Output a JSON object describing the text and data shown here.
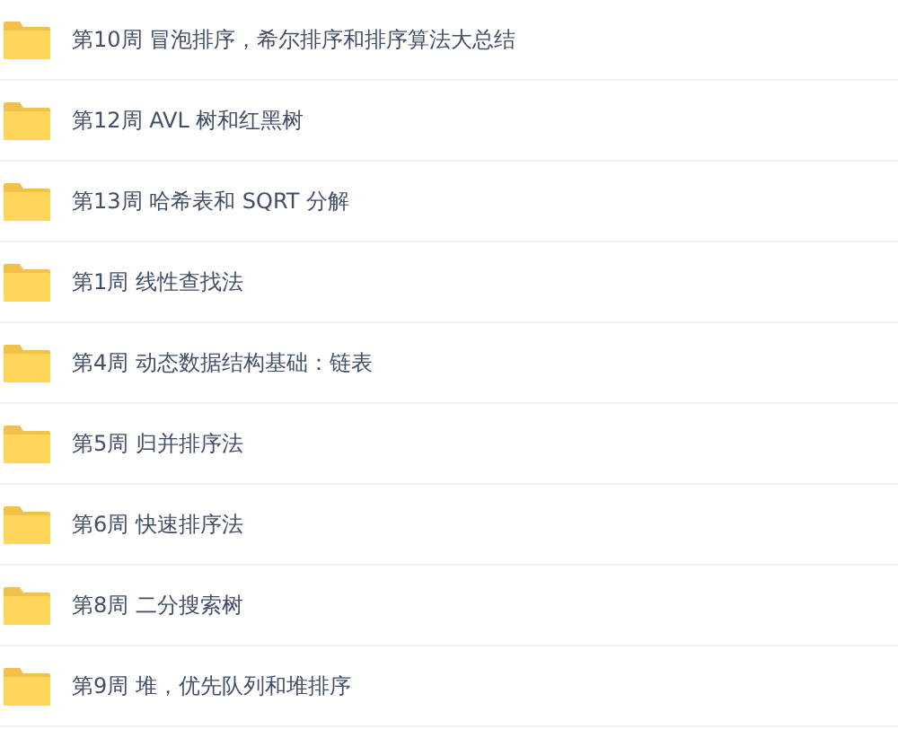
{
  "folders": [
    {
      "name": "第10周 冒泡排序，希尔排序和排序算法大总结"
    },
    {
      "name": "第12周 AVL 树和红黑树"
    },
    {
      "name": "第13周 哈希表和 SQRT 分解"
    },
    {
      "name": "第1周 线性查找法"
    },
    {
      "name": "第4周 动态数据结构基础：链表"
    },
    {
      "name": "第5周 归并排序法"
    },
    {
      "name": "第6周 快速排序法"
    },
    {
      "name": "第8周 二分搜索树"
    },
    {
      "name": "第9周 堆，优先队列和堆排序"
    }
  ]
}
